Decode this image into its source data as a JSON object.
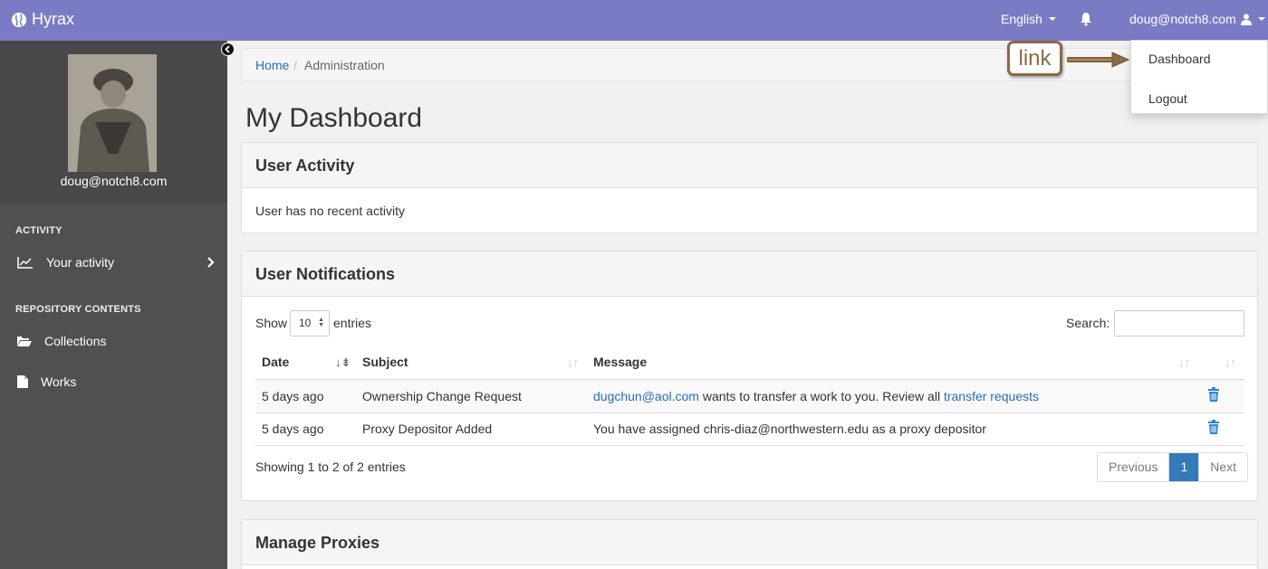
{
  "navbar": {
    "brand": "Hyrax",
    "language": "English",
    "user_email": "doug@notch8.com"
  },
  "dropdown": {
    "items": [
      "Dashboard",
      "Logout"
    ]
  },
  "annotation": {
    "label": "link"
  },
  "sidebar": {
    "profile_name": "doug@notch8.com",
    "sections": [
      {
        "label": "ACTIVITY",
        "items": [
          {
            "label": "Your activity",
            "icon": "line-chart-icon"
          }
        ]
      },
      {
        "label": "REPOSITORY CONTENTS",
        "items": [
          {
            "label": "Collections",
            "icon": "folder-open-icon"
          },
          {
            "label": "Works",
            "icon": "file-icon"
          }
        ]
      }
    ]
  },
  "breadcrumb": {
    "home": "Home",
    "separator": "/",
    "current": "Administration"
  },
  "page": {
    "title": "My Dashboard"
  },
  "user_activity": {
    "title": "User Activity",
    "message": "User has no recent activity"
  },
  "notifications": {
    "title": "User Notifications",
    "show_label": "Show",
    "page_size": "10",
    "entries_label": "entries",
    "search_label": "Search:",
    "columns": [
      "Date",
      "Subject",
      "Message"
    ],
    "rows": [
      {
        "date": "5 days ago",
        "subject": "Ownership Change Request",
        "message_link": "dugchun@aol.com",
        "message_text": " wants to transfer a work to you. Review all ",
        "message_link2": "transfer requests"
      },
      {
        "date": "5 days ago",
        "subject": "Proxy Depositor Added",
        "message_text": "You have assigned chris-diaz@northwestern.edu as a proxy depositor"
      }
    ],
    "summary": "Showing 1 to 2 of 2 entries",
    "pagination": {
      "previous": "Previous",
      "current": "1",
      "next": "Next"
    }
  },
  "proxies": {
    "title": "Manage Proxies"
  },
  "colors": {
    "navbar": "#7b7bc5",
    "sidebar": "#505050",
    "link": "#2a6ebb",
    "active_page": "#337ab7",
    "annotation": "#8b6a44"
  }
}
